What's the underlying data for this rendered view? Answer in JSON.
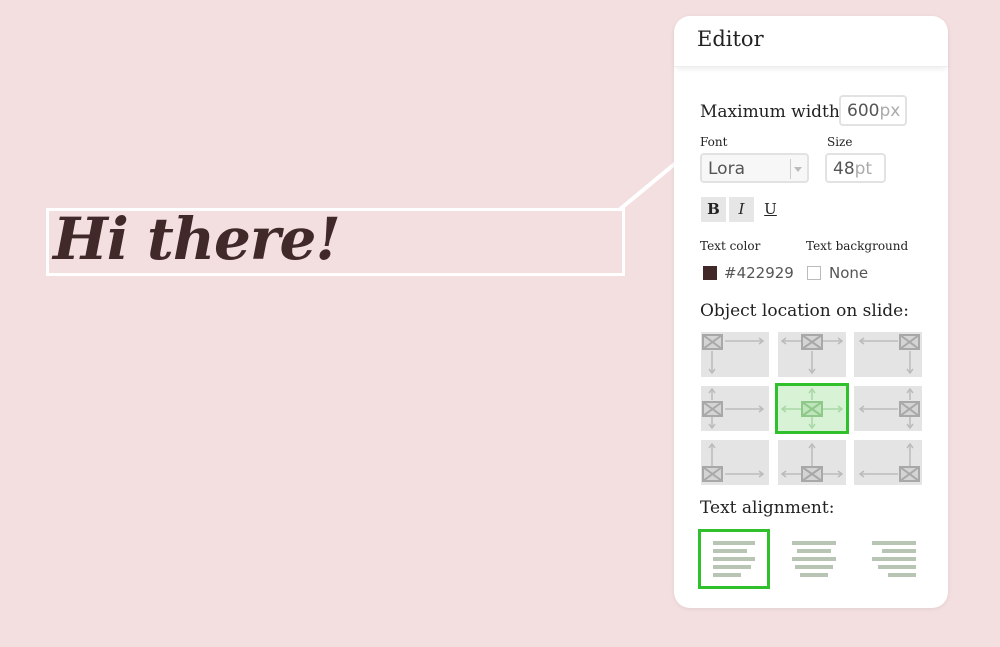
{
  "slide": {
    "text": "Hi there!",
    "text_color": "#422929",
    "background_color": "#f3dfe0"
  },
  "editor": {
    "title": "Editor",
    "max_width": {
      "label": "Maximum width:",
      "value": "600",
      "unit": "px"
    },
    "font": {
      "label": "Font",
      "value": "Lora"
    },
    "size": {
      "label": "Size",
      "value": "48",
      "unit": "pt"
    },
    "format_buttons": {
      "bold": "B",
      "italic": "I",
      "underline": "U"
    },
    "text_color": {
      "label": "Text color",
      "value": "#422929"
    },
    "text_background": {
      "label": "Text background",
      "value": "None"
    },
    "location": {
      "label": "Object location on slide:",
      "selected": "middle-center"
    },
    "alignment": {
      "label": "Text alignment:",
      "selected": "left"
    },
    "accent_color": "#2fc02b"
  }
}
